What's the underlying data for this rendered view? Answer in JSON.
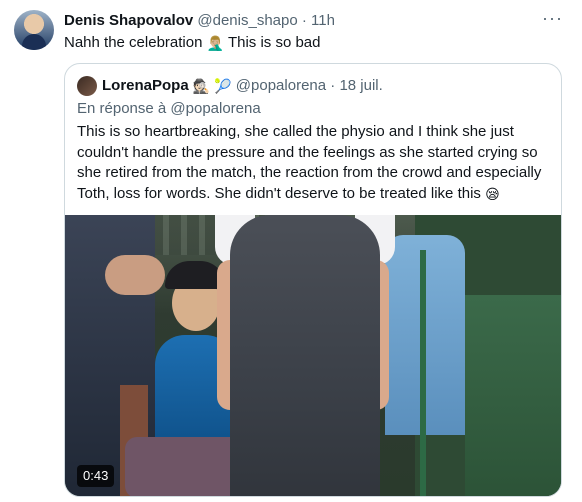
{
  "tweet": {
    "display_name": "Denis Shapovalov",
    "handle": "@denis_shapo",
    "separator": "·",
    "time": "11h",
    "text_before_emoji": "Nahh the celebration ",
    "emoji": "🤦🏼‍♂️",
    "text_after_emoji": " This is so bad",
    "more_label": "···"
  },
  "quote": {
    "display_name": "LorenaPopa",
    "badge_emojis": "🕵🏻 🎾",
    "handle": "@popalorena",
    "separator": "·",
    "date": "18 juil.",
    "reply_prefix": "En réponse à ",
    "reply_mention": "@popalorena",
    "text": "This is so heartbreaking, she called the physio and I think she just couldn't handle the pressure and the feelings as she started crying so she retired from the match, the reaction from the crowd and especially Toth, loss for words. She didn't deserve to be treated like this ",
    "text_emoji": "😪",
    "media": {
      "duration": "0:43"
    }
  }
}
